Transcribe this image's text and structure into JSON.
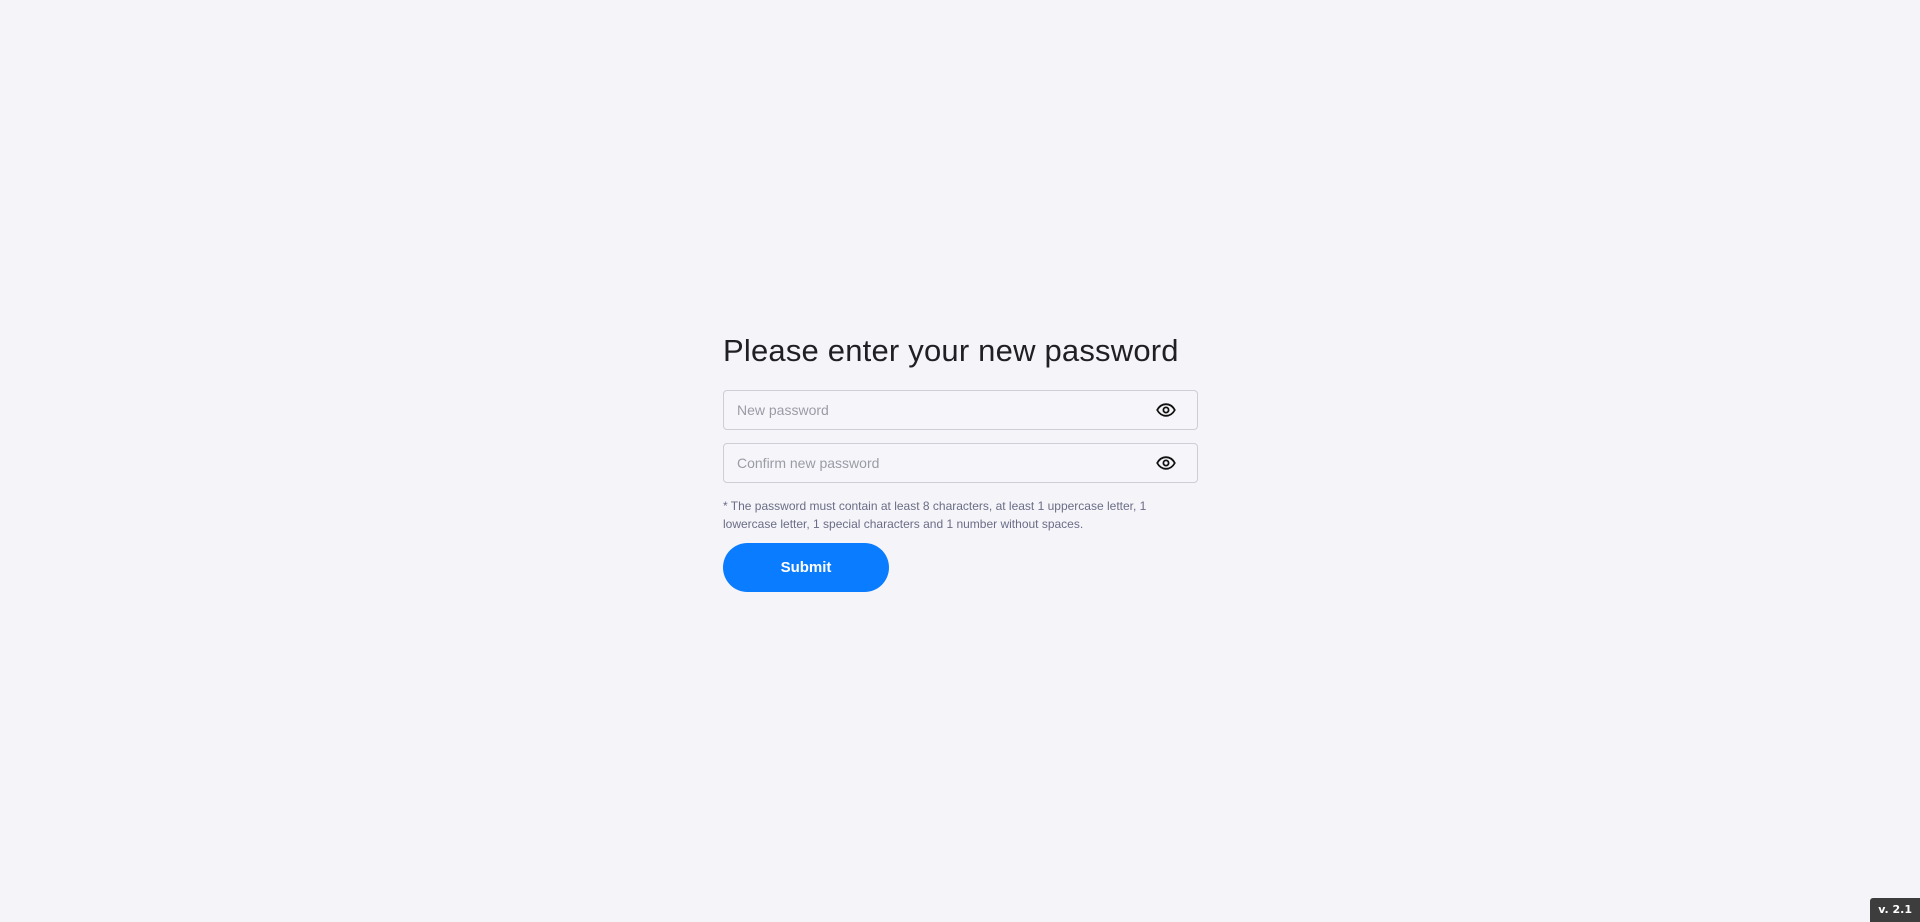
{
  "form": {
    "title": "Please enter your new password",
    "new_password": {
      "placeholder": "New password",
      "value": "",
      "toggle_icon": "eye-icon"
    },
    "confirm_password": {
      "placeholder": "Confirm new password",
      "value": "",
      "toggle_icon": "eye-icon"
    },
    "hint": "* The password must contain at least 8 characters, at least 1 uppercase letter, 1 lowercase letter, 1 special characters and 1 number without spaces.",
    "submit_label": "Submit"
  },
  "footer": {
    "version": "v. 2.1"
  },
  "colors": {
    "background": "#f4f4f9",
    "accent": "#0a7cff",
    "hint_text": "#6b6d86",
    "version_badge": "#3d3d3d"
  }
}
